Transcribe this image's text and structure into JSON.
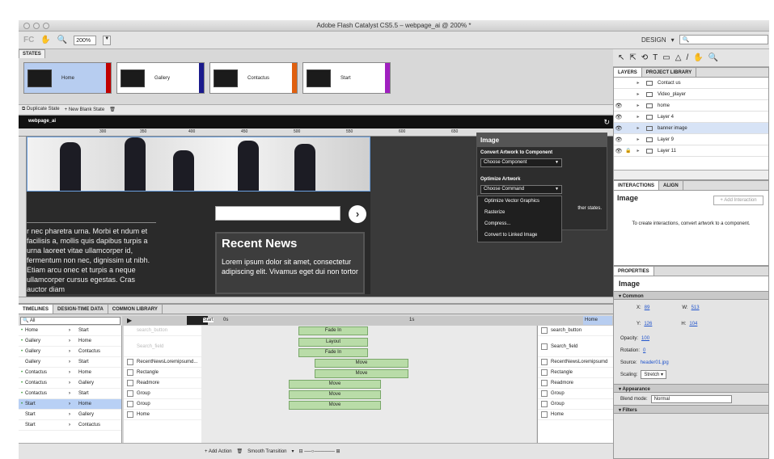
{
  "window": {
    "title": "Adobe Flash Catalyst CS5.5 – webpage_ai @ 200% *"
  },
  "toolbar": {
    "logo": "FC",
    "zoom": "200%",
    "workspace": "DESIGN"
  },
  "states": {
    "tab": "STATES",
    "items": [
      {
        "label": "Home",
        "color": "#c00000"
      },
      {
        "label": "Gallery",
        "color": "#1a1a8c"
      },
      {
        "label": "Contactus",
        "color": "#e06010"
      },
      {
        "label": "Start",
        "color": "#a020c0"
      }
    ],
    "duplicate": "Duplicate State",
    "new_blank": "New Blank State"
  },
  "canvas": {
    "doc": "webpage_ai",
    "ruler": [
      "300",
      "350",
      "400",
      "450",
      "500",
      "550",
      "600",
      "650"
    ],
    "lorem": "r nec pharetra urna. Morbi et ndum et facilisis a, mollis quis dapibus turpis a urna laoreet vitae ullamcorper id, fermentum non nec, dignissim ut nibh. Etiam arcu onec et turpis a neque ullamcorper cursus egestas. Cras auctor diam",
    "news_title": "Recent News",
    "news_text": "Lorem ipsum dolor sit amet, consectetur adipiscing elit. Vivamus eget dui non tortor"
  },
  "image_panel": {
    "title": "Image",
    "convert_label": "Convert Artwork to Component",
    "convert_select": "Choose Component",
    "optimize_label": "Optimize Artwork",
    "optimize_select": "Choose Command",
    "menu": [
      "Optimize Vector Graphics",
      "Rasterize",
      "Compress...",
      "Convert to Linked Image"
    ],
    "other_states": "ther states."
  },
  "layers": {
    "tabs": [
      "LAYERS",
      "PROJECT LIBRARY"
    ],
    "rows": [
      "Contact us",
      "Video_player",
      "home",
      "Layer 4",
      "banner image",
      "Layer 9",
      "Layer 11"
    ]
  },
  "interactions": {
    "tabs": [
      "INTERACTIONS",
      "ALIGN"
    ],
    "name": "Image",
    "add": "+ Add Interaction",
    "msg": "To create interactions, convert artwork to a component."
  },
  "properties": {
    "tab": "PROPERTIES",
    "name": "Image",
    "common": "Common",
    "x_label": "X:",
    "x": "89",
    "w_label": "W:",
    "w": "513",
    "y_label": "Y:",
    "y": "126",
    "h_label": "H:",
    "h": "104",
    "opacity_label": "Opacity:",
    "opacity": "100",
    "rotation_label": "Rotation:",
    "rotation": "0",
    "source_label": "Source:",
    "source": "header01.jpg",
    "scaling_label": "Scaling:",
    "scaling": "Stretch",
    "appearance": "Appearance",
    "blend_label": "Blend mode:",
    "blend": "Normal",
    "filters": "Filters"
  },
  "timeline": {
    "tabs": [
      "TIMELINES",
      "DESIGN-TIME DATA",
      "COMMON LIBRARY"
    ],
    "filter": "All",
    "start_state": "Start",
    "end_state": "Home",
    "ruler": [
      "0s",
      "1s"
    ],
    "transitions": [
      {
        "from": "Home",
        "to": "Start"
      },
      {
        "from": "Gallery",
        "to": "Home"
      },
      {
        "from": "Gallery",
        "to": "Contactus"
      },
      {
        "from": "Gallery",
        "to": "Start"
      },
      {
        "from": "Contactus",
        "to": "Home"
      },
      {
        "from": "Contactus",
        "to": "Gallery"
      },
      {
        "from": "Contactus",
        "to": "Start"
      },
      {
        "from": "Start",
        "to": "Home"
      },
      {
        "from": "Start",
        "to": "Gallery"
      },
      {
        "from": "Start",
        "to": "Contactus"
      }
    ],
    "objects": [
      "search_button",
      "Search_field",
      "RecentNewsLoremipsumd...",
      "Rectangle",
      "Readmore",
      "Group",
      "Group",
      "Home"
    ],
    "end_objects": [
      "search_button",
      "Search_field",
      "RecentNewsLoremipsumd",
      "Rectangle",
      "Readmore",
      "Group",
      "Group",
      "Home"
    ],
    "segments": [
      "Fade In",
      "Layout",
      "Fade In",
      "Move",
      "Move",
      "Move",
      "Move",
      "Move"
    ],
    "add_action": "+ Add Action",
    "smooth": "Smooth Transition"
  }
}
